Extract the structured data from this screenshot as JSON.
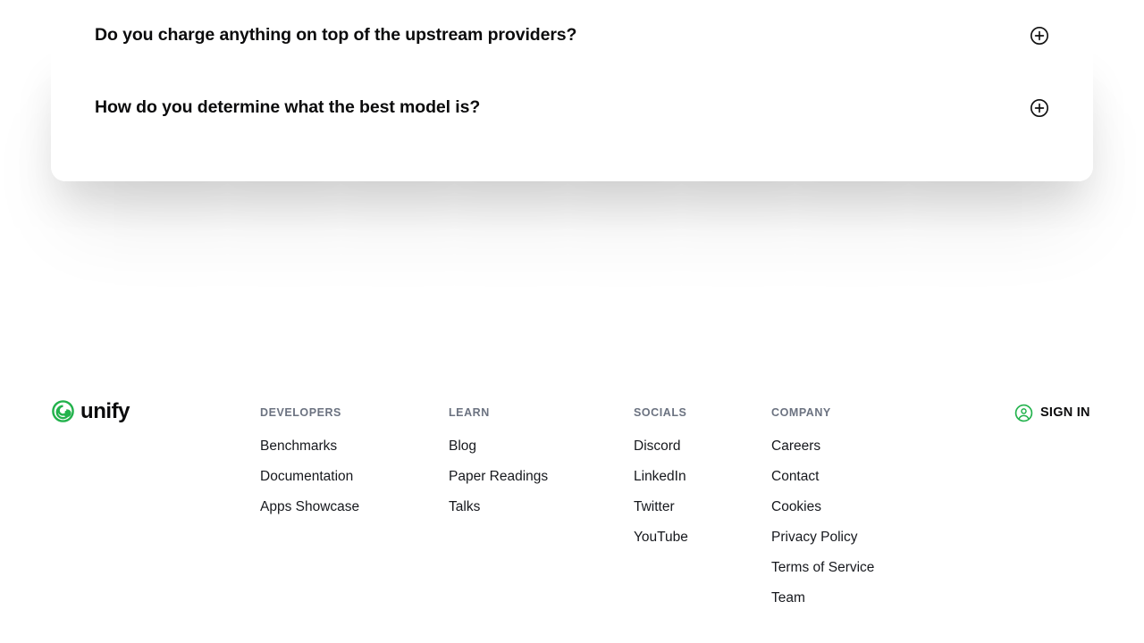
{
  "faq": {
    "items": [
      {
        "question": "Do you charge anything on top of the upstream providers?",
        "toggle_icon": "plus-circle-icon"
      },
      {
        "question": "How do you determine what the best model is?",
        "toggle_icon": "plus-circle-icon"
      }
    ]
  },
  "footer": {
    "brand": {
      "name": "unify",
      "logo_icon": "unify-spiral-logo-icon"
    },
    "columns": [
      {
        "title": "DEVELOPERS",
        "links": [
          "Benchmarks",
          "Documentation",
          "Apps Showcase"
        ]
      },
      {
        "title": "LEARN",
        "links": [
          "Blog",
          "Paper Readings",
          "Talks"
        ]
      },
      {
        "title": "SOCIALS",
        "links": [
          "Discord",
          "LinkedIn",
          "Twitter",
          "YouTube"
        ]
      },
      {
        "title": "COMPANY",
        "links": [
          "Careers",
          "Contact",
          "Cookies",
          "Privacy Policy",
          "Terms of Service",
          "Team"
        ]
      }
    ],
    "sign_in": {
      "label": "SIGN IN",
      "icon": "user-circle-icon"
    }
  },
  "colors": {
    "brand_green": "#22b24c",
    "text_primary": "#0b0b0c",
    "text_link": "#16181d",
    "text_muted": "#6b7280",
    "page_background": "#ffffff",
    "card_background": "#ffffff"
  }
}
